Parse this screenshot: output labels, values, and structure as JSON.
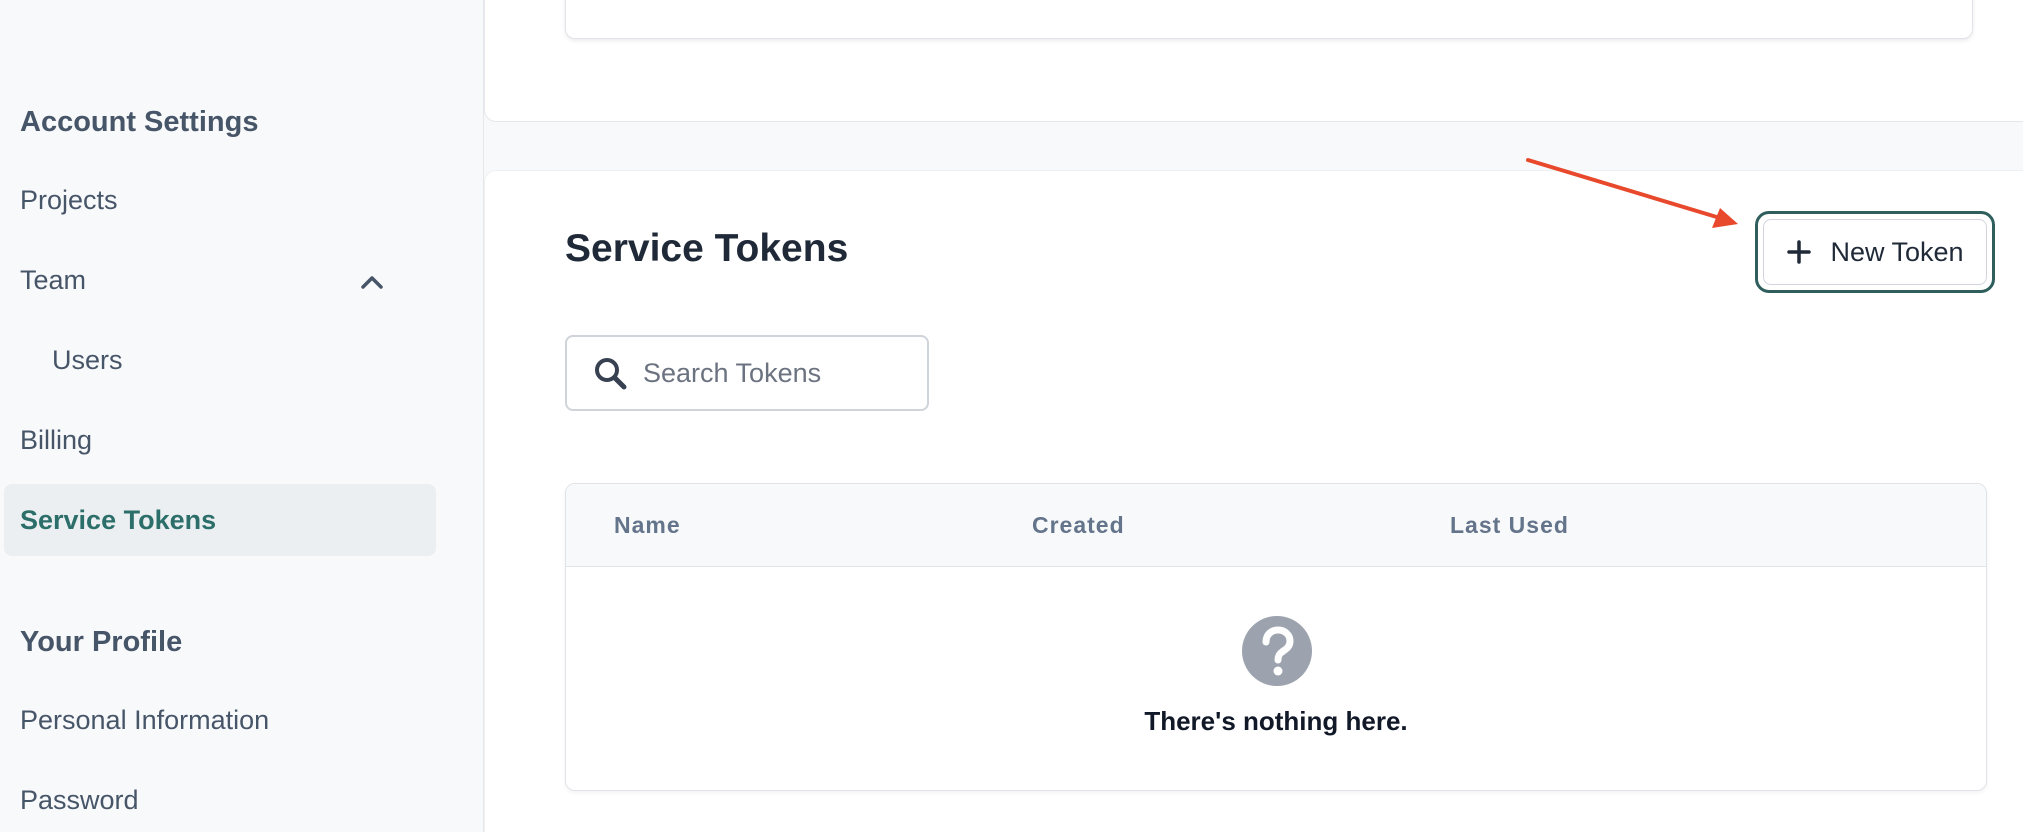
{
  "sidebar": {
    "account_title": "Account Settings",
    "items": [
      {
        "label": "Projects"
      },
      {
        "label": "Team"
      },
      {
        "label": "Users"
      },
      {
        "label": "Billing"
      },
      {
        "label": "Service Tokens"
      }
    ],
    "profile_title": "Your Profile",
    "profile_items": [
      {
        "label": "Personal Information"
      },
      {
        "label": "Password"
      }
    ]
  },
  "main": {
    "heading": "Service Tokens",
    "new_token_label": "New Token",
    "search": {
      "placeholder": "Search Tokens"
    },
    "table": {
      "columns": [
        "Name",
        "Created",
        "Last Used"
      ],
      "empty_text": "There's nothing here."
    }
  },
  "icons": {
    "search": "search-icon",
    "empty": "question-circle-icon",
    "plus": "plus-icon",
    "chevron": "chevron-up-icon"
  },
  "colors": {
    "accent": "#2c6e6a",
    "highlight_border": "#2f5f5c",
    "annotation_arrow": "#e8492c"
  }
}
